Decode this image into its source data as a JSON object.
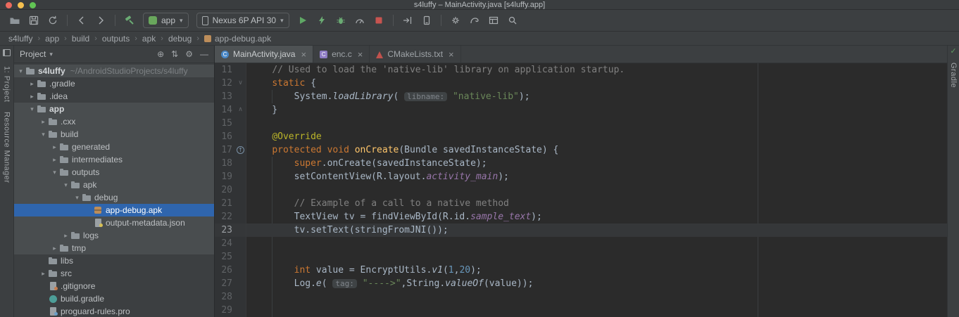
{
  "window": {
    "title": "s4luffy – MainActivity.java [s4luffy.app]"
  },
  "toolbar": {
    "run_config_label": "app",
    "device_label": "Nexus 6P API 30"
  },
  "breadcrumbs": {
    "items": [
      "s4luffy",
      "app",
      "build",
      "outputs",
      "apk",
      "debug",
      "app-debug.apk"
    ]
  },
  "left_stripe": {
    "items": [
      "1: Project",
      "Resource Manager"
    ]
  },
  "right_stripe": {
    "items": [
      "Gradle"
    ],
    "status": "inspections-ok"
  },
  "project_panel": {
    "title": "Project",
    "tree": [
      {
        "label": "s4luffy",
        "sub": "~/AndroidStudioProjects/s4luffy",
        "level": 0,
        "chevron": "open",
        "icon": "folder",
        "hl": true,
        "bold": true
      },
      {
        "label": ".gradle",
        "level": 1,
        "chevron": "closed",
        "icon": "folder"
      },
      {
        "label": ".idea",
        "level": 1,
        "chevron": "closed",
        "icon": "folder"
      },
      {
        "label": "app",
        "level": 1,
        "chevron": "open",
        "icon": "folder-app",
        "hl": true,
        "bold": true
      },
      {
        "label": ".cxx",
        "level": 2,
        "chevron": "closed",
        "icon": "folder",
        "hl": true
      },
      {
        "label": "build",
        "level": 2,
        "chevron": "open",
        "icon": "folder",
        "hl": true
      },
      {
        "label": "generated",
        "level": 3,
        "chevron": "closed",
        "icon": "folder",
        "hl": true
      },
      {
        "label": "intermediates",
        "level": 3,
        "chevron": "closed",
        "icon": "folder",
        "hl": true
      },
      {
        "label": "outputs",
        "level": 3,
        "chevron": "open",
        "icon": "folder",
        "hl": true
      },
      {
        "label": "apk",
        "level": 4,
        "chevron": "open",
        "icon": "folder",
        "hl": true
      },
      {
        "label": "debug",
        "level": 5,
        "chevron": "open",
        "icon": "folder",
        "hl": true
      },
      {
        "label": "app-debug.apk",
        "level": 6,
        "chevron": null,
        "icon": "apk",
        "sel": true
      },
      {
        "label": "output-metadata.json",
        "level": 6,
        "chevron": null,
        "icon": "json",
        "hl": true
      },
      {
        "label": "logs",
        "level": 4,
        "chevron": "closed",
        "icon": "folder",
        "hl": true
      },
      {
        "label": "tmp",
        "level": 3,
        "chevron": "closed",
        "icon": "folder",
        "hl": true
      },
      {
        "label": "libs",
        "level": 2,
        "chevron": null,
        "icon": "folder"
      },
      {
        "label": "src",
        "level": 2,
        "chevron": "closed",
        "icon": "folder"
      },
      {
        "label": ".gitignore",
        "level": 2,
        "chevron": null,
        "icon": "git"
      },
      {
        "label": "build.gradle",
        "level": 2,
        "chevron": null,
        "icon": "gradle"
      },
      {
        "label": "proguard-rules.pro",
        "level": 2,
        "chevron": null,
        "icon": "pro"
      }
    ]
  },
  "editor": {
    "tabs": [
      {
        "label": "MainActivity.java",
        "icon": "java",
        "active": true
      },
      {
        "label": "enc.c",
        "icon": "c",
        "active": false
      },
      {
        "label": "CMakeLists.txt",
        "icon": "cmake",
        "active": false
      }
    ],
    "lines": [
      {
        "n": 11,
        "s": [
          [
            "t",
            "    "
          ],
          [
            "cmt",
            "// Used to load the 'native-lib' library on application startup."
          ]
        ]
      },
      {
        "n": 12,
        "g": "fold-open",
        "s": [
          [
            "t",
            "    "
          ],
          [
            "kw",
            "static"
          ],
          [
            "t",
            " {"
          ]
        ]
      },
      {
        "n": 13,
        "s": [
          [
            "t",
            "        System."
          ],
          [
            "ita",
            "loadLibrary"
          ],
          [
            "t",
            "( "
          ],
          [
            "hint",
            "libname:"
          ],
          [
            "t",
            " "
          ],
          [
            "str",
            "\"native-lib\""
          ],
          [
            "t",
            ");"
          ]
        ]
      },
      {
        "n": 14,
        "g": "fold-close",
        "s": [
          [
            "t",
            "    }"
          ]
        ]
      },
      {
        "n": 15,
        "s": []
      },
      {
        "n": 16,
        "s": [
          [
            "t",
            "    "
          ],
          [
            "ann",
            "@Override"
          ]
        ]
      },
      {
        "n": 17,
        "g": "override",
        "s": [
          [
            "t",
            "    "
          ],
          [
            "kw",
            "protected"
          ],
          [
            "t",
            " "
          ],
          [
            "kw",
            "void"
          ],
          [
            "t",
            " "
          ],
          [
            "mth",
            "onCreate"
          ],
          [
            "t",
            "(Bundle savedInstanceState) {"
          ]
        ]
      },
      {
        "n": 18,
        "s": [
          [
            "t",
            "        "
          ],
          [
            "kw",
            "super"
          ],
          [
            "t",
            ".onCreate(savedInstanceState);"
          ]
        ]
      },
      {
        "n": 19,
        "s": [
          [
            "t",
            "        setContentView(R.layout."
          ],
          [
            "fld",
            "activity_main"
          ],
          [
            "t",
            ");"
          ]
        ]
      },
      {
        "n": 20,
        "s": []
      },
      {
        "n": 21,
        "s": [
          [
            "t",
            "        "
          ],
          [
            "cmt",
            "// Example of a call to a native method"
          ]
        ]
      },
      {
        "n": 22,
        "s": [
          [
            "t",
            "        TextView tv = findViewById(R.id."
          ],
          [
            "fld",
            "sample_text"
          ],
          [
            "t",
            ");"
          ]
        ]
      },
      {
        "n": 23,
        "caret": true,
        "s": [
          [
            "t",
            "        tv.setText(stringFromJNI());"
          ]
        ]
      },
      {
        "n": 24,
        "s": []
      },
      {
        "n": 25,
        "s": []
      },
      {
        "n": 26,
        "s": [
          [
            "t",
            "        "
          ],
          [
            "kw",
            "int"
          ],
          [
            "t",
            " value = EncryptUtils."
          ],
          [
            "ita",
            "v1"
          ],
          [
            "t",
            "("
          ],
          [
            "num",
            "1"
          ],
          [
            "t",
            ","
          ],
          [
            "num",
            "20"
          ],
          [
            "t",
            ");"
          ]
        ]
      },
      {
        "n": 27,
        "s": [
          [
            "t",
            "        Log."
          ],
          [
            "ita",
            "e"
          ],
          [
            "t",
            "( "
          ],
          [
            "hint",
            "tag:"
          ],
          [
            "t",
            " "
          ],
          [
            "str",
            "\"---->\""
          ],
          [
            "t",
            ",String."
          ],
          [
            "ita",
            "valueOf"
          ],
          [
            "t",
            "(value));"
          ]
        ]
      },
      {
        "n": 28,
        "s": []
      },
      {
        "n": 29,
        "s": []
      }
    ]
  },
  "colors": {
    "chrome_bg": "#3c3f41",
    "editor_bg": "#2b2b2b",
    "gutter_bg": "#313335",
    "selection_blue": "#2f65ad",
    "tree_highlight": "#494d4f",
    "caret_line": "#353739",
    "keyword": "#cc7832",
    "string": "#6a8759",
    "comment": "#808080",
    "number": "#6897bb",
    "annotation": "#bbb529",
    "method_decl": "#ffc66b",
    "static_member": "#9876aa",
    "run_green": "#6aab73",
    "stop_red": "#c75450",
    "inspection_ok_green": "#5f9b61"
  }
}
